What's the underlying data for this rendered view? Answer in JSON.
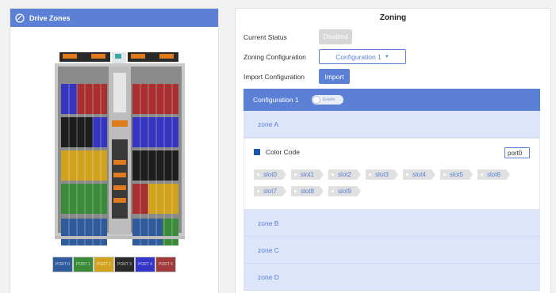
{
  "left": {
    "title": "Drive Zones",
    "ports": [
      {
        "label": "PORT 0",
        "color": "#2f5a9c"
      },
      {
        "label": "PORT 1",
        "color": "#3a8a3a"
      },
      {
        "label": "PORT 2",
        "color": "#d1a21e"
      },
      {
        "label": "PORT 3",
        "color": "#2a2a2a"
      },
      {
        "label": "PORT 4",
        "color": "#3535c8"
      },
      {
        "label": "PORT 5",
        "color": "#a13a3a"
      }
    ]
  },
  "right": {
    "title": "Zoning",
    "status_label": "Current Status",
    "status_button": "Disabled",
    "zoning_label": "Zoning Configuration",
    "zoning_select": "Configuration 1",
    "import_label": "Import Configuration",
    "import_button": "Import",
    "config_title": "Configuration 1",
    "toggle_label": "Enable",
    "zones": [
      {
        "name": "zone A"
      },
      {
        "name": "zone B"
      },
      {
        "name": "zone C"
      },
      {
        "name": "zone D"
      }
    ],
    "zone_a": {
      "color_label": "Color Code",
      "color": "#1e56a8",
      "port_value": "port0",
      "slots": [
        "slot0",
        "slot1",
        "slot2",
        "slot3",
        "slot4",
        "slot5",
        "slot6",
        "slot7",
        "slot8",
        "slot9"
      ]
    }
  }
}
